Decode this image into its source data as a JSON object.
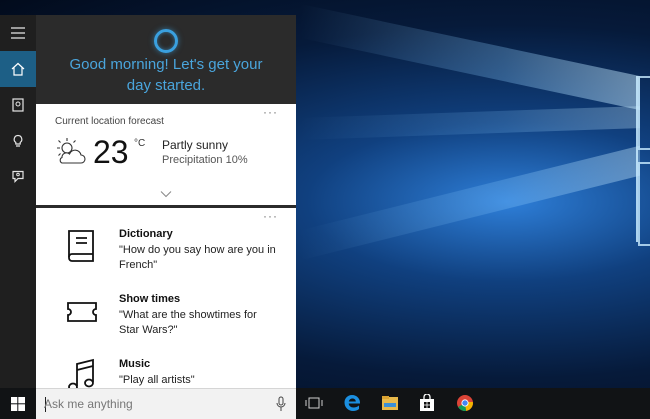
{
  "cortana": {
    "greeting_line1": "Good morning! Let's get your",
    "greeting_line2": "day started."
  },
  "rail": {
    "items": [
      {
        "icon": "hamburger-menu-icon"
      },
      {
        "icon": "home-icon",
        "active": true
      },
      {
        "icon": "notebook-icon"
      },
      {
        "icon": "lightbulb-icon"
      },
      {
        "icon": "feedback-icon"
      }
    ]
  },
  "weather": {
    "label": "Current location forecast",
    "temperature": "23",
    "unit": "°C",
    "condition": "Partly sunny",
    "precipitation": "Precipitation 10%",
    "menu": "···"
  },
  "tips": {
    "menu": "···",
    "items": [
      {
        "title": "Dictionary",
        "text": "\"How do you say how are you in French\"",
        "icon": "book-icon"
      },
      {
        "title": "Show times",
        "text": "\"What are the showtimes for Star Wars?\"",
        "icon": "ticket-icon"
      },
      {
        "title": "Music",
        "text": "\"Play all artists\"",
        "icon": "music-note-icon"
      }
    ]
  },
  "taskbar": {
    "search_placeholder": "Ask me anything",
    "apps": [
      "task-view-icon",
      "edge-icon",
      "file-explorer-icon",
      "store-icon",
      "chrome-icon"
    ]
  },
  "colors": {
    "accent": "#4aa5dc",
    "rail_active": "#1d5f86",
    "panel_dark": "#2b2b2b"
  }
}
